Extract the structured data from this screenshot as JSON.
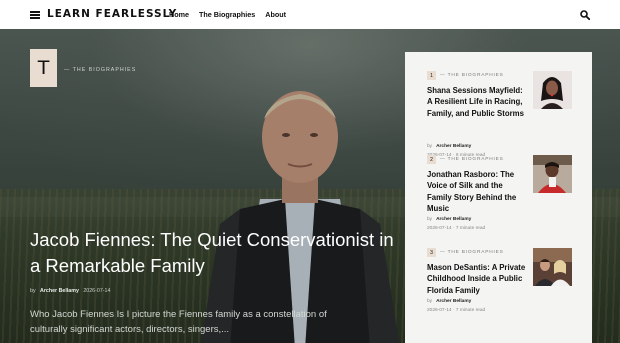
{
  "header": {
    "logo": "LEARN FEARLESSLY",
    "nav": [
      "Home",
      "The Biographies",
      "About"
    ]
  },
  "hero": {
    "badge_letter": "T",
    "category": "— THE BIOGRAPHIES",
    "title": "Jacob Fiennes: The Quiet Conservationist in a Remarkable Family",
    "meta_by": "by",
    "meta_author": "Archer Bellamy",
    "meta_date": "2026-07-14",
    "excerpt": "Who Jacob Fiennes Is I picture the Fiennes family as a constellation of culturally significant actors, directors, singers,..."
  },
  "sidebar": {
    "items": [
      {
        "num": "1",
        "category": "— THE BIOGRAPHIES",
        "title": "Shana Sessions Mayfield: A Resilient Life in Racing, Family, and Public Storms",
        "by": "by",
        "author": "Archer Bellamy",
        "date": "2026-07-14",
        "sep": "·",
        "read": "6 minute read"
      },
      {
        "num": "2",
        "category": "— THE BIOGRAPHIES",
        "title": "Jonathan Rasboro: The Voice of Silk and the Family Story Behind the Music",
        "by": "by",
        "author": "Archer Bellamy",
        "date": "2026-07-14",
        "sep": "·",
        "read": "7 minute read"
      },
      {
        "num": "3",
        "category": "— THE BIOGRAPHIES",
        "title": "Mason DeSantis: A Private Childhood Inside a Public Florida Family",
        "by": "by",
        "author": "Archer Bellamy",
        "date": "2026-07-14",
        "sep": "·",
        "read": "7 minute read"
      }
    ]
  },
  "icons": {
    "menu": "hamburger-menu-icon",
    "search": "search-icon"
  },
  "colors": {
    "badge": "#e8ddd0",
    "sidebar_bg": "#f4f4f2",
    "header_bg": "#ffffff"
  }
}
